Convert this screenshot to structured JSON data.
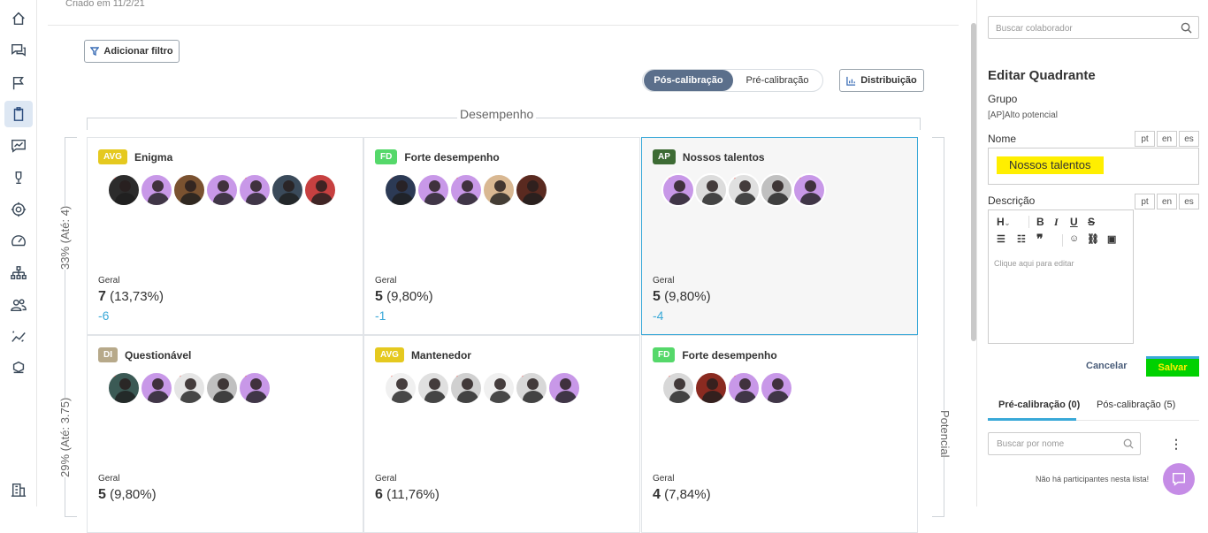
{
  "header": {
    "created": "Criado em 11/2/21"
  },
  "toolbar": {
    "filter_label": "Adicionar filtro",
    "toggle_on": "Pós-calibração",
    "toggle_off": "Pré-calibração",
    "distribution_label": "Distribuição"
  },
  "grid": {
    "x_axis_label": "Desempenho",
    "y_axis_label": "Potencial",
    "rows": [
      {
        "label": "33% (Até: 4)"
      },
      {
        "label": "29% (Até: 3.75)"
      }
    ],
    "cells": [
      {
        "badge": "AVG",
        "badge_color": "#e5c91f",
        "title": "Enigma",
        "geral": "Geral",
        "count": "7",
        "pct": "(13,73%)",
        "delta": "-6",
        "avatars": [
          "#2c2c2c",
          "#c898e8",
          "#7a5230",
          "#c898e8",
          "#c898e8",
          "#3a4a5a",
          "#c74040"
        ]
      },
      {
        "badge": "FD",
        "badge_color": "#55d86a",
        "title": "Forte desempenho",
        "geral": "Geral",
        "count": "5",
        "pct": "(9,80%)",
        "delta": "-1",
        "avatars": [
          "#2c3a55",
          "#c898e8",
          "#c898e8",
          "#d9b892",
          "#5a2a20"
        ]
      },
      {
        "badge": "AP",
        "badge_color": "#3d6b34",
        "title": "Nossos talentos",
        "geral": "Geral",
        "count": "5",
        "pct": "(9,80%)",
        "delta": "-4",
        "avatars": [
          "#c898e8",
          "#dcdcdc",
          "#e0e0e0",
          "#c0c0c0",
          "#c898e8"
        ]
      },
      {
        "badge": "DI",
        "badge_color": "#b7a98a",
        "title": "Questionável",
        "geral": "Geral",
        "count": "5",
        "pct": "(9,80%)",
        "delta": "",
        "avatars": [
          "#3b5a55",
          "#c898e8",
          "#e5e5e5",
          "#c0c0c0",
          "#c898e8"
        ]
      },
      {
        "badge": "AVG",
        "badge_color": "#e5c91f",
        "title": "Mantenedor",
        "geral": "Geral",
        "count": "6",
        "pct": "(11,76%)",
        "delta": "",
        "avatars": [
          "#f0f0f0",
          "#e0e0e0",
          "#d0d0d0",
          "#f0f0f0",
          "#d8d8d8",
          "#c898e8"
        ]
      },
      {
        "badge": "FD",
        "badge_color": "#55d86a",
        "title": "Forte desempenho",
        "geral": "Geral",
        "count": "4",
        "pct": "(7,84%)",
        "delta": "",
        "avatars": [
          "#d8d8d8",
          "#8a2a20",
          "#c898e8",
          "#c898e8"
        ]
      }
    ]
  },
  "panel": {
    "search_placeholder": "Buscar colaborador",
    "title": "Editar Quadrante",
    "group_label": "Grupo",
    "group_value": "[AP]Alto potencial",
    "name_label": "Nome",
    "name_value": "Nossos talentos",
    "langs": [
      "pt",
      "en",
      "es"
    ],
    "desc_label": "Descrição",
    "desc_placeholder": "Clique aqui para editar",
    "cancel": "Cancelar",
    "save": "Salvar",
    "tab_pre": "Pré-calibração (0)",
    "tab_post": "Pós-calibração (5)",
    "name_search_placeholder": "Buscar por nome",
    "empty": "Não há participantes nesta lista!"
  },
  "colors": {
    "accent": "#3aa9d8",
    "toggle_active": "#5b6f8b",
    "highlight": "#ffef00",
    "save_bg": "#00d100"
  }
}
